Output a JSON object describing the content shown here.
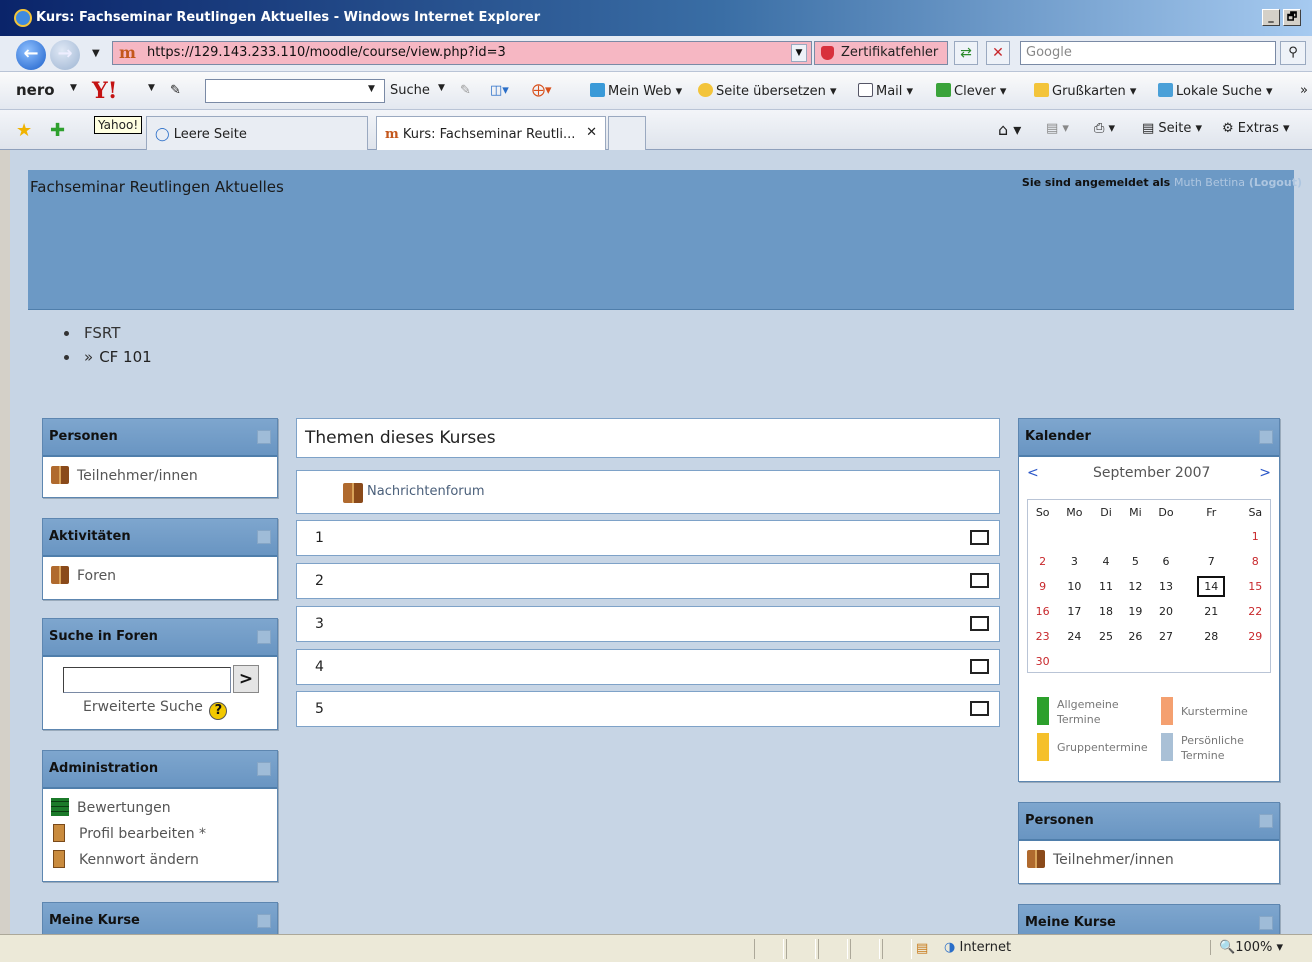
{
  "window": {
    "title": "Kurs: Fachseminar Reutlingen Aktuelles - Windows Internet Explorer",
    "min": "_",
    "max": "🗗"
  },
  "address": {
    "url": "https://129.143.233.110/moodle/course/view.php?id=3",
    "cert_error": "Zertifikatfehler",
    "search_placeholder": "Google"
  },
  "toolbar": {
    "nero": "nero",
    "yahoo": "Y!",
    "suche": "Suche",
    "mein_web": "Mein Web",
    "seite_uebersetzen": "Seite übersetzen",
    "mail": "Mail",
    "clever": "Clever",
    "grusskarten": "Grußkarten",
    "lokale_suche": "Lokale Suche"
  },
  "tabs": {
    "yahoo_tooltip": "Yahoo!",
    "leere_seite": "Leere Seite",
    "active": "Kurs: Fachseminar Reutli...",
    "seite": "Seite",
    "extras": "Extras"
  },
  "page": {
    "heading": "Fachseminar Reutlingen Aktuelles",
    "login_prefix": "Sie sind angemeldet als",
    "user": "Muth Bettina",
    "logout": "(Logout)",
    "breadcrumbs": [
      "FSRT",
      "CF 101"
    ],
    "breadcrumb_sep": "»"
  },
  "left_blocks": {
    "personen": {
      "title": "Personen",
      "items": [
        "Teilnehmer/innen"
      ]
    },
    "aktivitaeten": {
      "title": "Aktivitäten",
      "items": [
        "Foren"
      ]
    },
    "suche": {
      "title": "Suche in Foren",
      "go": ">",
      "advanced": "Erweiterte Suche",
      "help": "?"
    },
    "administration": {
      "title": "Administration",
      "items": [
        "Bewertungen",
        "Profil bearbeiten *",
        "Kennwort ändern"
      ]
    },
    "meine_kurse": {
      "title": "Meine Kurse"
    }
  },
  "main": {
    "title": "Themen dieses Kurses",
    "forum": "Nachrichtenforum",
    "sections": [
      "1",
      "2",
      "3",
      "4",
      "5"
    ]
  },
  "calendar": {
    "title": "Kalender",
    "month": "September 2007",
    "prev": "<",
    "next": ">",
    "weekdays": [
      "So",
      "Mo",
      "Di",
      "Mi",
      "Do",
      "Fr",
      "Sa"
    ],
    "weeks": [
      [
        "",
        "",
        "",
        "",
        "",
        "",
        "1"
      ],
      [
        "2",
        "3",
        "4",
        "5",
        "6",
        "7",
        "8"
      ],
      [
        "9",
        "10",
        "11",
        "12",
        "13",
        "14",
        "15"
      ],
      [
        "16",
        "17",
        "18",
        "19",
        "20",
        "21",
        "22"
      ],
      [
        "23",
        "24",
        "25",
        "26",
        "27",
        "28",
        "29"
      ],
      [
        "30",
        "",
        "",
        "",
        "",
        "",
        ""
      ]
    ],
    "today": "14",
    "legend": {
      "allgemeine": "Allgemeine Termine",
      "kurs": "Kurstermine",
      "gruppen": "Gruppentermine",
      "persoenlich": "Persönliche Termine"
    },
    "legend_colors": {
      "allgemeine": "#2ca02c",
      "kurs": "#f4a070",
      "gruppen": "#f5c02a",
      "persoenlich": "#a9c0d6"
    }
  },
  "right_blocks": {
    "personen": {
      "title": "Personen",
      "items": [
        "Teilnehmer/innen"
      ]
    },
    "meine_kurse": {
      "title": "Meine Kurse"
    }
  },
  "status": {
    "zone": "Internet",
    "zoom": "100%"
  }
}
